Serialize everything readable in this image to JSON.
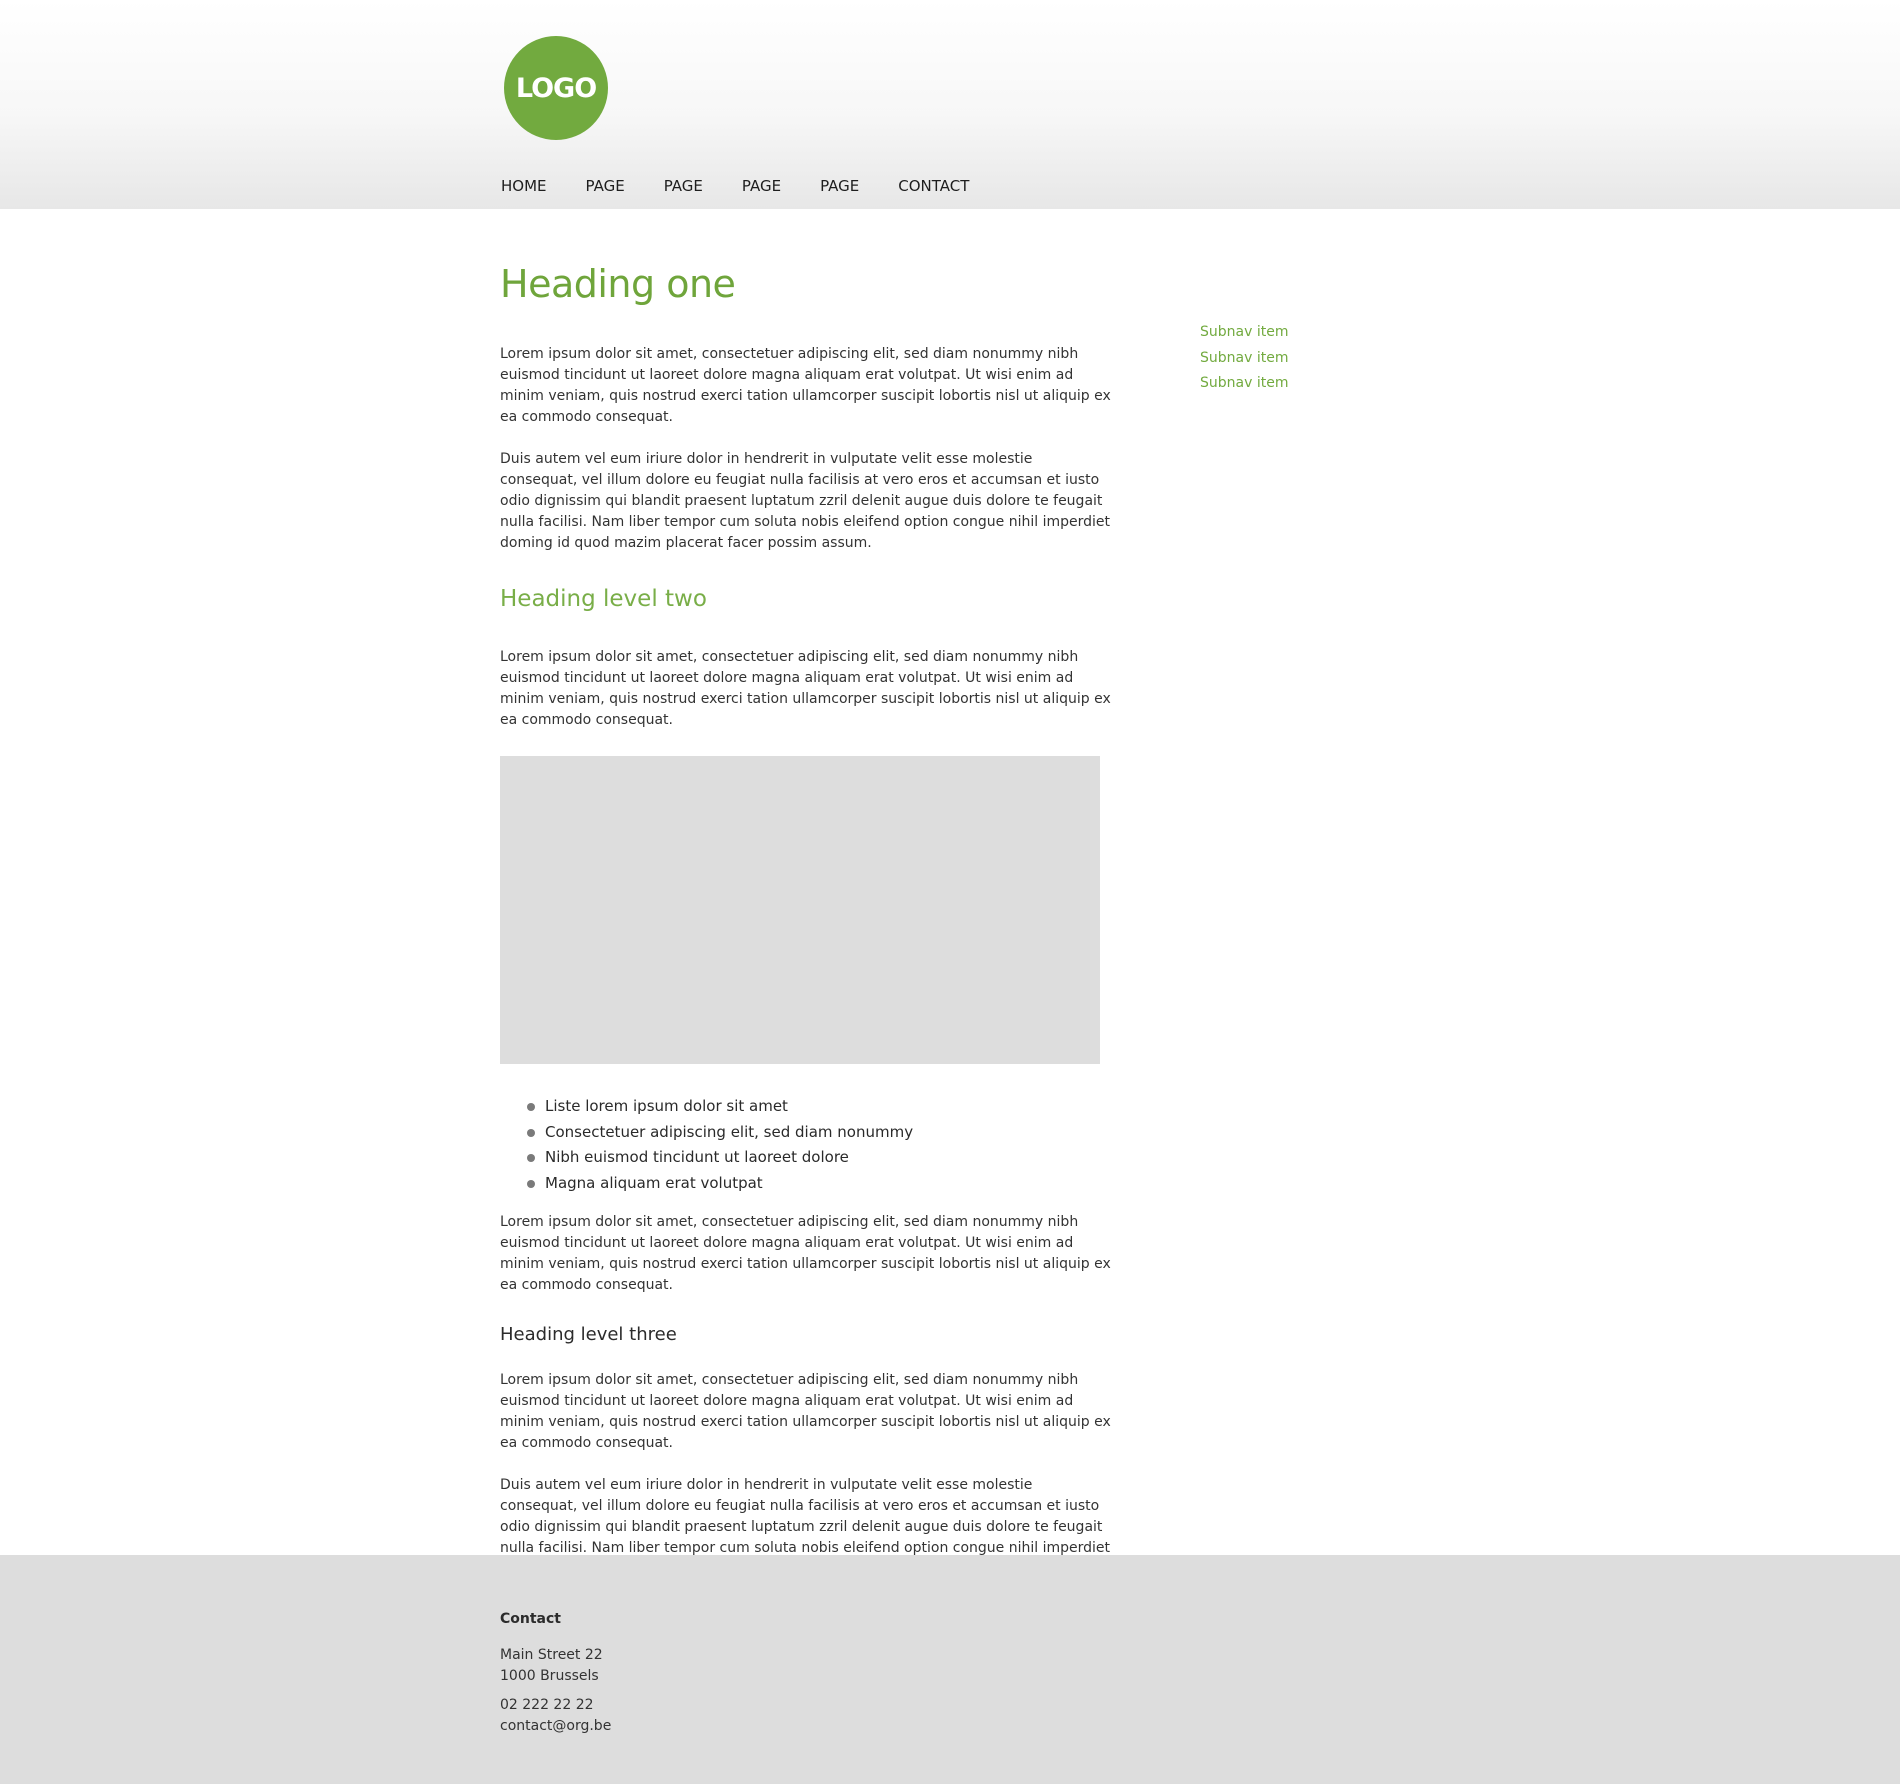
{
  "header": {
    "logo_text": "LOGO",
    "logo_color": "#72aa3f",
    "nav": [
      "HOME",
      "PAGE",
      "PAGE",
      "PAGE",
      "PAGE",
      "CONTACT"
    ]
  },
  "content": {
    "heading_one": "Heading one",
    "paragraph_1": "Lorem ipsum dolor sit amet, consectetuer adipiscing elit, sed diam nonummy nibh euismod tincidunt ut laoreet dolore magna aliquam erat volutpat. Ut wisi enim ad minim veniam, quis nostrud exerci tation ullamcorper suscipit lobortis nisl ut aliquip ex ea commodo consequat.",
    "paragraph_2": "Duis autem vel eum iriure dolor in hendrerit in vulputate velit esse molestie consequat, vel illum dolore eu feugiat nulla facilisis at vero eros et accumsan et iusto odio dignissim qui blandit praesent luptatum zzril delenit augue duis dolore te feugait nulla facilisi. Nam liber tempor cum soluta nobis eleifend option congue nihil imperdiet doming id quod mazim placerat facer possim assum.",
    "heading_two": "Heading level two",
    "paragraph_3": "Lorem ipsum dolor sit amet, consectetuer adipiscing elit, sed diam nonummy nibh euismod tincidunt ut laoreet dolore magna aliquam erat volutpat. Ut wisi enim ad minim veniam, quis nostrud exerci tation ullamcorper suscipit lobortis nisl ut aliquip ex ea commodo consequat.",
    "list_items": [
      "Liste lorem ipsum dolor sit amet",
      "Consectetuer adipiscing elit, sed diam nonummy",
      "Nibh euismod tincidunt ut laoreet dolore",
      "Magna aliquam erat volutpat"
    ],
    "paragraph_4": "Lorem ipsum dolor sit amet, consectetuer adipiscing elit, sed diam nonummy nibh euismod tincidunt ut laoreet dolore magna aliquam erat volutpat. Ut wisi enim ad minim veniam, quis nostrud exerci tation ullamcorper suscipit lobortis nisl ut aliquip ex ea commodo consequat.",
    "heading_three": "Heading level three",
    "paragraph_5": "Lorem ipsum dolor sit amet, consectetuer adipiscing elit, sed diam nonummy nibh euismod tincidunt ut laoreet dolore magna aliquam erat volutpat. Ut wisi enim ad minim veniam, quis nostrud exerci tation ullamcorper suscipit lobortis nisl ut aliquip ex ea commodo consequat.",
    "paragraph_6": "Duis autem vel eum iriure dolor in hendrerit in vulputate velit esse molestie consequat, vel illum dolore eu feugiat nulla facilisis at vero eros et accumsan et iusto odio dignissim qui blandit praesent luptatum zzril delenit augue duis dolore te feugait nulla facilisi. Nam liber tempor cum soluta nobis eleifend option congue nihil imperdiet doming id quod mazim placerat facer possim assum."
  },
  "subnav": [
    "Subnav item",
    "Subnav item",
    "Subnav item"
  ],
  "footer": {
    "title": "Contact",
    "address_line_1": "Main Street 22",
    "address_line_2": "1000 Brussels",
    "phone": "02 222 22 22",
    "email": "contact@org.be"
  },
  "colors": {
    "accent": "#72aa3f",
    "footer_bg": "#dddddd",
    "image_placeholder": "#dddddd"
  }
}
